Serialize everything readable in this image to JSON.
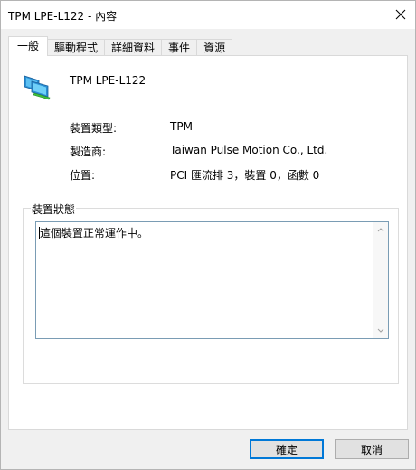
{
  "window": {
    "title": "TPM LPE-L122 - 內容"
  },
  "tabs": [
    {
      "label": "一般",
      "active": true
    },
    {
      "label": "驅動程式",
      "active": false
    },
    {
      "label": "詳細資料",
      "active": false
    },
    {
      "label": "事件",
      "active": false
    },
    {
      "label": "資源",
      "active": false
    }
  ],
  "device": {
    "icon": "monitor-icon",
    "name": "TPM LPE-L122"
  },
  "properties": [
    {
      "label": "裝置類型:",
      "value": "TPM"
    },
    {
      "label": "製造商:",
      "value": "Taiwan Pulse Motion Co., Ltd."
    },
    {
      "label": "位置:",
      "value": "PCI 匯流排 3，裝置 0，函數 0"
    }
  ],
  "status": {
    "legend": "裝置狀態",
    "text": "這個裝置正常運作中。"
  },
  "buttons": {
    "ok_label": "確定",
    "cancel_label": "取消"
  },
  "colors": {
    "accent": "#0078d7",
    "status_border": "#7a9cb4",
    "dialog_bg": "#f0f0f0"
  }
}
